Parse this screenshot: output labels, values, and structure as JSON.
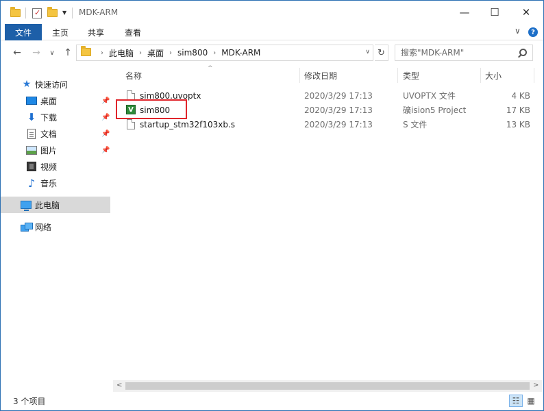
{
  "window": {
    "title": "MDK-ARM",
    "minimize_glyph": "—",
    "maximize_glyph": "☐",
    "close_glyph": "✕"
  },
  "ribbon": {
    "tabs": [
      "文件",
      "主页",
      "共享",
      "查看"
    ],
    "expand_glyph": "∨",
    "help_glyph": "?"
  },
  "address": {
    "crumbs": [
      "此电脑",
      "桌面",
      "sim800",
      "MDK-ARM"
    ],
    "back_glyph": "←",
    "forward_glyph": "→",
    "recent_glyph": "∨",
    "up_glyph": "↑",
    "refresh_glyph": "↻",
    "search_placeholder": "搜索\"MDK-ARM\""
  },
  "nav": {
    "quick_access": "快速访问",
    "items": [
      {
        "label": "桌面",
        "icon": "desktop-icon",
        "pinned": true
      },
      {
        "label": "下载",
        "icon": "download-icon",
        "pinned": true
      },
      {
        "label": "文档",
        "icon": "document-icon",
        "pinned": true
      },
      {
        "label": "图片",
        "icon": "picture-icon",
        "pinned": true
      },
      {
        "label": "视频",
        "icon": "video-icon",
        "pinned": false
      },
      {
        "label": "音乐",
        "icon": "music-icon",
        "pinned": false
      }
    ],
    "this_pc": "此电脑",
    "network": "网络",
    "pin_glyph": "📌"
  },
  "columns": {
    "name": "名称",
    "date": "修改日期",
    "type": "类型",
    "size": "大小",
    "sort_glyph": "^"
  },
  "files": [
    {
      "name": "sim800.uvoptx",
      "date": "2020/3/29 17:13",
      "type": "UVOPTX 文件",
      "size": "4 KB",
      "icon": "file-icon"
    },
    {
      "name": "sim800",
      "date": "2020/3/29 17:13",
      "type": "礦ision5 Project",
      "size": "17 KB",
      "icon": "uvision-project-icon"
    },
    {
      "name": "startup_stm32f103xb.s",
      "date": "2020/3/29 17:13",
      "type": "S 文件",
      "size": "13 KB",
      "icon": "file-icon"
    }
  ],
  "project_icon_glyph": "V",
  "scroll": {
    "left_glyph": "<",
    "right_glyph": ">"
  },
  "status": {
    "count": "3 个项目"
  },
  "colors": {
    "accent": "#1d5fa8",
    "highlight": "#e0252b"
  }
}
